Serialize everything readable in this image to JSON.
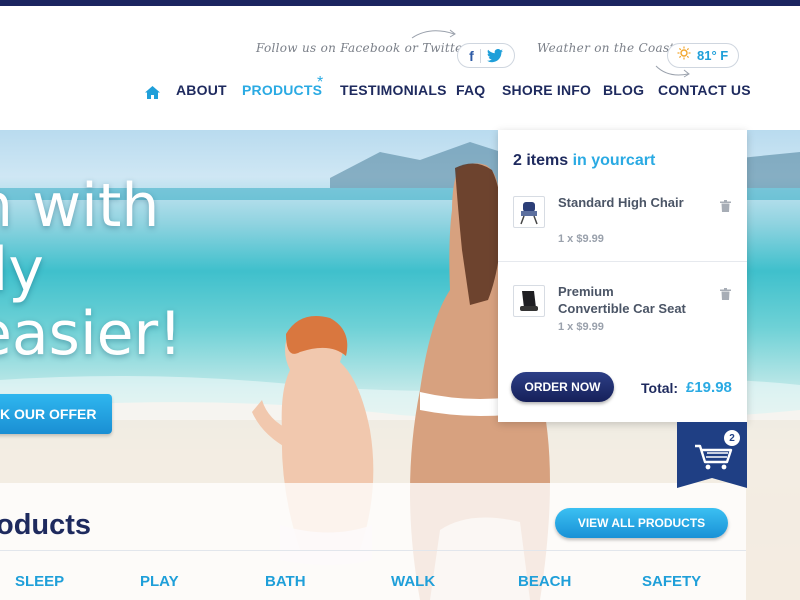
{
  "header": {
    "follow_text": "Follow us on Facebook or Twitter",
    "facebook_label": "f",
    "weather_text": "Weather on the Coast",
    "temperature": "81° F"
  },
  "nav": {
    "items": [
      "ABOUT",
      "PRODUCTS",
      "TESTIMONIALS",
      "FAQ",
      "SHORE INFO",
      "BLOG",
      "CONTACT US"
    ],
    "active_marker": "*"
  },
  "hero": {
    "line1": "n with",
    "line2": "ily",
    "line3": "easier!",
    "offer_button": "K OUR OFFER"
  },
  "products": {
    "title": "oducts",
    "view_all": "VIEW ALL PRODUCTS",
    "categories": [
      "SLEEP",
      "PLAY",
      "BATH",
      "WALK",
      "BEACH",
      "SAFETY"
    ]
  },
  "cart": {
    "count_text": "2 items",
    "title_suffix": "in yourcart",
    "items": [
      {
        "name": "Standard High Chair",
        "qty": "1 x $9.99"
      },
      {
        "name": "Premium Convertible Car Seat",
        "qty": "1 x $9.99"
      }
    ],
    "order_button": "ORDER NOW",
    "total_label": "Total:",
    "total_value": "£19.98",
    "badge": "2"
  },
  "colors": {
    "navy": "#1e2a5e",
    "accent": "#2aaae3",
    "topstripe": "#1b2560"
  },
  "icons": [
    "home-icon",
    "twitter-icon",
    "sun-icon",
    "trash-icon",
    "shopping-cart-icon"
  ]
}
